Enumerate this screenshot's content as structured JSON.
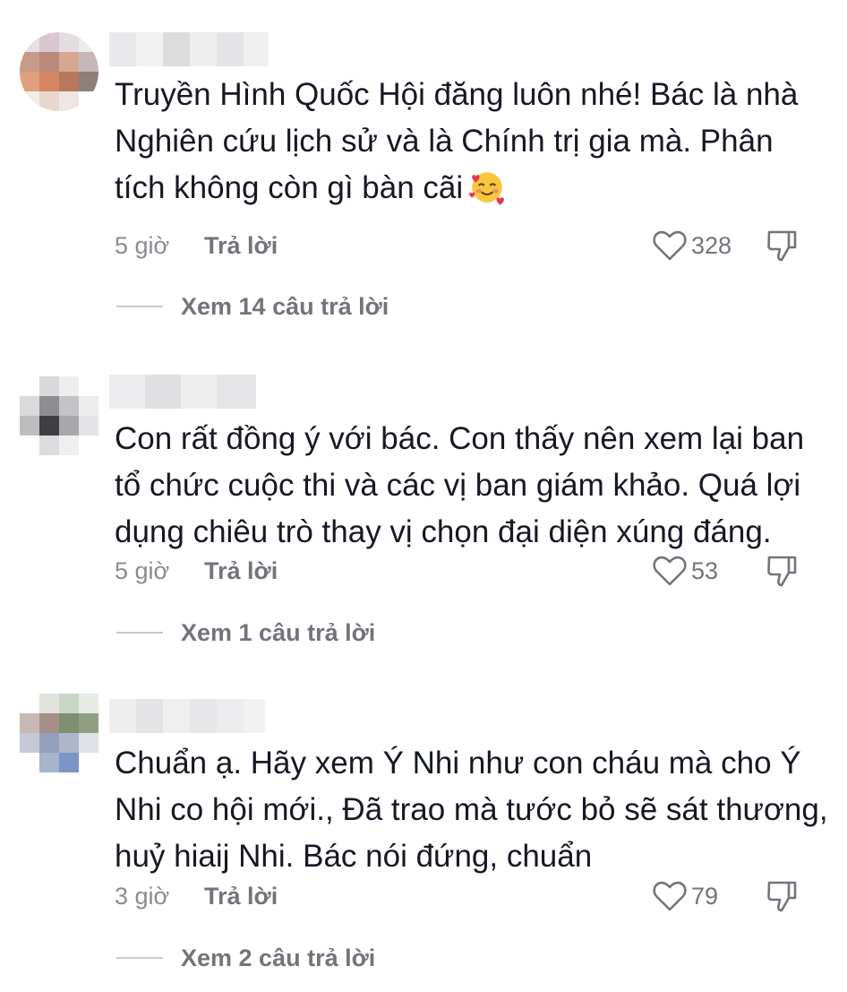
{
  "comments": [
    {
      "text": "Truyền Hình Quốc Hội đăng luôn nhé! Bác là nhà Nghiên cứu lịch sử và là Chính trị gia mà. Phân tích không còn gì bàn cãi",
      "emoji": "smiling-face-with-hearts",
      "time": "5 giờ",
      "reply_label": "Trả lời",
      "likes": "328",
      "view_replies": "Xem 14 câu trả lời"
    },
    {
      "text": "Con rất đồng ý với bác. Con thấy nên xem lại ban tổ chức cuộc thi và các vị ban giám khảo. Quá lợi dụng chiêu trò thay vị chọn đại diện xúng đáng.",
      "time": "5 giờ",
      "reply_label": "Trả lời",
      "likes": "53",
      "view_replies": "Xem 1 câu trả lời"
    },
    {
      "text": "Chuẩn ạ. Hãy xem Ý Nhi như con cháu mà cho Ý Nhi co hội mới., Đã trao mà tước bỏ sẽ sát thương, huỷ hiaij Nhi. Bác nói đứng, chuẩn",
      "time": "3 giờ",
      "reply_label": "Trả lời",
      "likes": "79",
      "view_replies": "Xem 2 câu trả lời"
    }
  ],
  "icons": {
    "like": "heart-outline-icon",
    "dislike": "thumbs-down-icon"
  },
  "colors": {
    "text": "#161823",
    "muted": "#73747b",
    "time": "#8a8b91"
  }
}
